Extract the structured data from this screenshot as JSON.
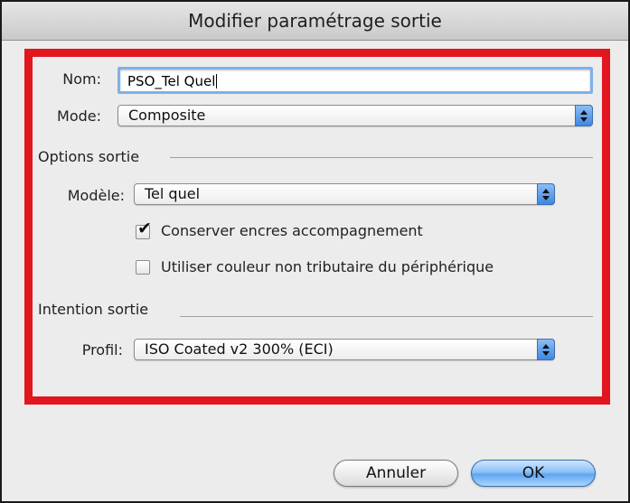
{
  "window": {
    "title": "Modifier paramétrage sortie"
  },
  "form": {
    "name_label": "Nom:",
    "name_value": "PSO_Tel Quel",
    "mode_label": "Mode:",
    "mode_value": "Composite"
  },
  "output_options": {
    "section_title": "Options sortie",
    "model_label": "Modèle:",
    "model_value": "Tel quel",
    "checkbox_keep_inks": {
      "label": "Conserver encres accompagnement",
      "checked": true
    },
    "checkbox_device_independent": {
      "label": "Utiliser couleur non tributaire du périphérique",
      "checked": false
    }
  },
  "output_intent": {
    "section_title": "Intention sortie",
    "profile_label": "Profil:",
    "profile_value": "ISO Coated v2 300% (ECI)"
  },
  "buttons": {
    "cancel": "Annuler",
    "ok": "OK"
  },
  "colors": {
    "highlight": "#e2161f",
    "accent": "#5fa6ef"
  },
  "icons": {
    "check": "✔"
  }
}
